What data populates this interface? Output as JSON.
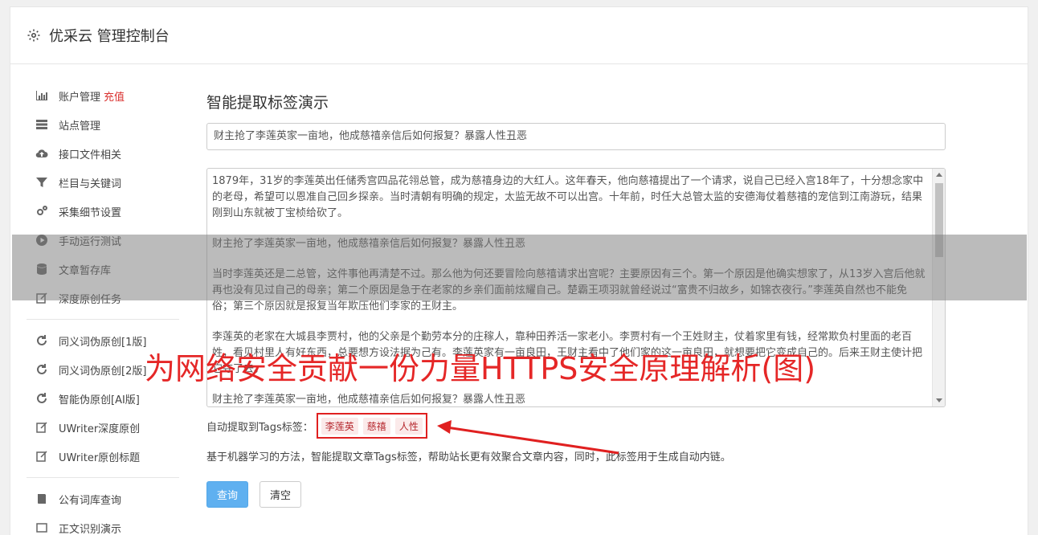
{
  "header": {
    "title": "优采云 管理控制台",
    "icon": "gear-icon"
  },
  "sidebar": {
    "group1": [
      {
        "label": "账户管理",
        "highlight": "充值",
        "icon": "bar-chart-icon"
      },
      {
        "label": "站点管理",
        "icon": "server-icon"
      },
      {
        "label": "接口文件相关",
        "icon": "cloud-upload-icon"
      },
      {
        "label": "栏目与关键词",
        "icon": "filter-icon"
      },
      {
        "label": "采集细节设置",
        "icon": "cogs-icon"
      },
      {
        "label": "手动运行测试",
        "icon": "play-circle-icon"
      },
      {
        "label": "文章暂存库",
        "icon": "database-icon"
      },
      {
        "label": "深度原创任务",
        "icon": "edit-icon"
      }
    ],
    "group2": [
      {
        "label": "同义词伪原创[1版]",
        "icon": "refresh-icon"
      },
      {
        "label": "同义词伪原创[2版]",
        "icon": "refresh-icon"
      },
      {
        "label": "智能伪原创[AI版]",
        "icon": "refresh-icon"
      },
      {
        "label": "UWriter深度原创",
        "icon": "edit-icon"
      },
      {
        "label": "UWriter原创标题",
        "icon": "edit-icon"
      }
    ],
    "group3": [
      {
        "label": "公有词库查询",
        "icon": "book-icon"
      },
      {
        "label": "正文识别演示",
        "icon": "window-icon"
      }
    ]
  },
  "main": {
    "page_title": "智能提取标签演示",
    "title_input_value": "财主抢了李莲英家一亩地，他成慈禧亲信后如何报复？暴露人性丑恶",
    "body_paragraphs": [
      "1879年，31岁的李莲英出任储秀宫四品花翎总管，成为慈禧身边的大红人。这年春天，他向慈禧提出了一个请求，说自己已经入宫18年了，十分想念家中的老母，希望可以恩准自己回乡探亲。当时清朝有明确的规定，太监无故不可以出宫。十年前，时任大总管太监的安德海仗着慈禧的宠信到江南游玩，结果刚到山东就被丁宝桢给砍了。",
      "财主抢了李莲英家一亩地，他成慈禧亲信后如何报复？暴露人性丑恶",
      "当时李莲英还是二总管，这件事他再清楚不过。那么他为何还要冒险向慈禧请求出宫呢？主要原因有三个。第一个原因是他确实想家了，从13岁入宫后他就再也没有见过自己的母亲；第二个原因是急于在老家的乡亲们面前炫耀自己。楚霸王项羽就曾经说过“富贵不归故乡，如锦衣夜行。”李莲英自然也不能免俗；第三个原因就是报复当年欺压他们李家的王财主。",
      "李莲英的老家在大城县李贾村，他的父亲是个勤劳本分的庄稼人，靠种田养活一家老小。李贾村有一个王姓财主，仗着家里有钱，经常欺负村里面的老百姓，看见村里人有好东西，总要想方设法据为己有。李莲英家有一亩良田，王财主看中了他们家的这一亩良田，就想要把它变成自己的。后来王财主使计把它夺了去。",
      "财主抢了李莲英家一亩地，他成慈禧亲信后如何报复？暴露人性丑恶"
    ],
    "tags_label": "自动提取到Tags标签：",
    "tags": [
      "李莲英",
      "慈禧",
      "人性"
    ],
    "description": "基于机器学习的方法，智能提取文章Tags标签，帮助站长更有效聚合文章内容，同时，此标签用于生成自动内链。",
    "query_button": "查询",
    "clear_button": "清空"
  },
  "overlay": {
    "watermark": "为网络安全贡献一份力量HTTPS安全原理解析(图)",
    "watermark_color": "#e52727"
  }
}
